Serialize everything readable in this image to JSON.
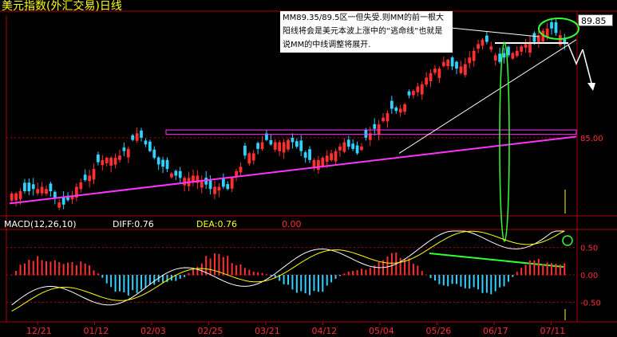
{
  "title": "美元指数(外汇交易)日线",
  "annotation": "MM89.35/89.5区一但失受.则MM的前一根大阳线将会是美元本波上涨中的“逃命线”也就是说MM的中线调整将展开.",
  "price_tag": "89.85",
  "indicator": {
    "name": "MACD(12,26,10)",
    "diff_label": "DIFF:0.76",
    "dea_label": "DEA:0.76",
    "macd_label": "0.00"
  },
  "colors": {
    "up": "#ff3030",
    "down": "#30d0ff",
    "support": "#ff33ff",
    "trend": "#ffffff",
    "annotation": "#33ff33",
    "grid": "#b00000",
    "axis_text": "#ff3030",
    "diff_line": "#ffffff",
    "dea_line": "#ffff00"
  },
  "chart_data": [
    {
      "type": "candlestick",
      "title": "美元指数(外汇交易)日线",
      "x_tick_labels": [
        "12/21",
        "01/12",
        "02/03",
        "02/25",
        "03/21",
        "04/12",
        "05/04",
        "05/26",
        "06/17",
        "07/11"
      ],
      "y_tick_labels": [
        "85.00"
      ],
      "ylim": [
        81.6,
        90.5
      ],
      "last_price": 89.85,
      "close": [
        82.5,
        82.5,
        82.6,
        82.6,
        82.6,
        82.7,
        82.7,
        82.8,
        82.7,
        82.6,
        82.3,
        82.1,
        82.0,
        82.2,
        82.4,
        82.8,
        83.0,
        83.1,
        83.3,
        83.6,
        83.9,
        84.0,
        84.1,
        84.1,
        84.1,
        84.2,
        84.4,
        84.5,
        84.9,
        85.2,
        85.0,
        84.7,
        84.4,
        84.1,
        83.8,
        83.7,
        83.6,
        83.4,
        83.3,
        83.2,
        83.2,
        83.2,
        83.3,
        83.3,
        83.1,
        82.9,
        82.7,
        82.8,
        82.8,
        82.8,
        82.7,
        83.2,
        83.5,
        83.7,
        84.2,
        84.3,
        84.3,
        84.5,
        84.8,
        84.9,
        84.7,
        84.8,
        84.8,
        84.8,
        84.9,
        84.8,
        84.6,
        84.4,
        84.1,
        84.0,
        84.0,
        84.0,
        84.1,
        84.2,
        84.3,
        84.4,
        84.6,
        84.8,
        84.6,
        84.5,
        84.3,
        84.6,
        85.0,
        85.2,
        85.4,
        85.6,
        85.9,
        86.1,
        86.3,
        86.2,
        86.3,
        86.5,
        86.9,
        87.1,
        87.3,
        87.4,
        87.7,
        87.9,
        88.1,
        88.1,
        88.4,
        88.5,
        88.2,
        88.1,
        88.2,
        88.3,
        88.6,
        88.9,
        89.2,
        89.4,
        89.3,
        89.1,
        88.7,
        88.4,
        88.6,
        88.7,
        88.8,
        88.9,
        89.1,
        89.2,
        89.3,
        89.3,
        89.6,
        89.8,
        89.9,
        89.9,
        89.7,
        89.6,
        89.2
      ]
    },
    {
      "type": "line",
      "title": "MACD(12,26,10)",
      "ylim": [
        -0.8,
        0.8
      ],
      "y_tick_labels": [
        "0.50",
        "0.00",
        "-0.50"
      ],
      "series_names": [
        "DIFF",
        "DEA",
        "MACD"
      ],
      "last_values": {
        "DIFF": 0.76,
        "DEA": 0.76,
        "MACD": 0.0
      }
    }
  ]
}
